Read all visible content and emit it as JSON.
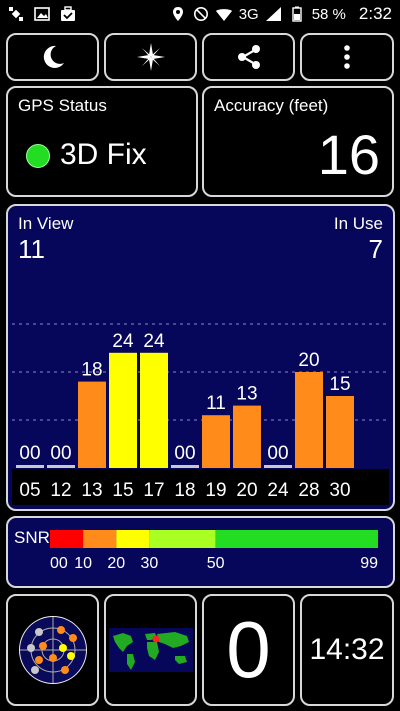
{
  "status_bar": {
    "icons_left": [
      "satellite-icon",
      "image-icon",
      "briefcase-check-icon"
    ],
    "icons_right": [
      "location-icon",
      "do-not-disturb-icon",
      "wifi-icon",
      "signal-icon",
      "battery-icon"
    ],
    "network": "3G",
    "battery": "58 %",
    "time": "2:32"
  },
  "toolbar": {
    "buttons": [
      "night-mode-icon",
      "compass-icon",
      "share-icon",
      "more-menu-icon"
    ]
  },
  "gps_status": {
    "label": "GPS Status",
    "value": "3D Fix",
    "indicator_color": "#22dd22"
  },
  "accuracy": {
    "label": "Accuracy (feet)",
    "value": "16"
  },
  "satellites": {
    "in_view_label": "In View",
    "in_view": "11",
    "in_use_label": "In Use",
    "in_use": "7"
  },
  "chart_data": {
    "type": "bar",
    "categories": [
      "05",
      "12",
      "13",
      "15",
      "17",
      "18",
      "19",
      "20",
      "24",
      "28",
      "30"
    ],
    "values": [
      0,
      0,
      18,
      24,
      24,
      0,
      11,
      13,
      0,
      20,
      15
    ],
    "value_labels": [
      "00",
      "00",
      "18",
      "24",
      "24",
      "00",
      "11",
      "13",
      "00",
      "20",
      "15"
    ],
    "colors": [
      "#c8c8c8",
      "#c8c8c8",
      "#ff8c1a",
      "#ffff00",
      "#ffff00",
      "#c8c8c8",
      "#ff8c1a",
      "#ff8c1a",
      "#c8c8c8",
      "#ff8c1a",
      "#ff8c1a"
    ],
    "ylim": [
      0,
      40
    ],
    "grid": true
  },
  "snr_legend": {
    "label": "SNR",
    "ticks": [
      "00",
      "10",
      "20",
      "30",
      "50",
      "99"
    ],
    "segments": [
      {
        "from": 0,
        "to": 10,
        "color": "#ff0000"
      },
      {
        "from": 10,
        "to": 20,
        "color": "#ff8c1a"
      },
      {
        "from": 20,
        "to": 30,
        "color": "#ffff00"
      },
      {
        "from": 30,
        "to": 50,
        "color": "#aaff22"
      },
      {
        "from": 50,
        "to": 99,
        "color": "#22dd22"
      }
    ]
  },
  "bottom": {
    "radar": "sky-radar-icon",
    "map": "world-map-icon",
    "counter": "0",
    "clock": "14:32"
  }
}
